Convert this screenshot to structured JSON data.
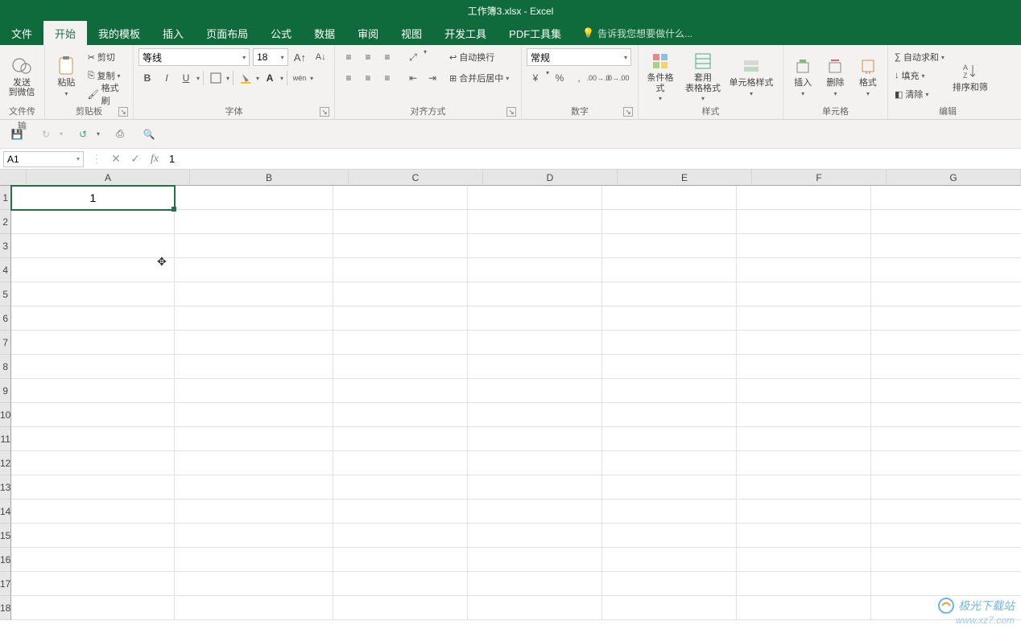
{
  "titlebar": {
    "text": "工作簿3.xlsx - Excel"
  },
  "menu": {
    "items": [
      "文件",
      "开始",
      "我的模板",
      "插入",
      "页面布局",
      "公式",
      "数据",
      "审阅",
      "视图",
      "开发工具",
      "PDF工具集"
    ],
    "active": "开始",
    "tellme_icon": "lightbulb-icon",
    "tellme": "告诉我您想要做什么..."
  },
  "ribbon": {
    "wechat": {
      "send_label": "发送",
      "to_label": "到微信",
      "group": "文件传输"
    },
    "clipboard": {
      "paste": "粘贴",
      "cut": "剪切",
      "copy": "复制",
      "painter": "格式刷",
      "group": "剪贴板"
    },
    "font": {
      "name": "等线",
      "size": "18",
      "bold": "B",
      "italic": "I",
      "underline": "U",
      "pinyin": "wén",
      "group": "字体"
    },
    "align": {
      "wrap": "自动换行",
      "merge": "合并后居中",
      "group": "对齐方式"
    },
    "number": {
      "format": "常规",
      "group": "数字"
    },
    "styles": {
      "cond": "条件格式",
      "table": "套用\n表格格式",
      "cell": "单元格样式",
      "group": "样式"
    },
    "cells": {
      "insert": "插入",
      "delete": "删除",
      "format": "格式",
      "group": "单元格"
    },
    "editing": {
      "sum": "自动求和",
      "fill": "填充",
      "clear": "清除",
      "sort": "排序和筛",
      "group": "编辑"
    }
  },
  "formula_bar": {
    "name": "A1",
    "value": "1"
  },
  "grid": {
    "columns": [
      "A",
      "B",
      "C",
      "D",
      "E",
      "F",
      "G"
    ],
    "rows": 18,
    "selected": {
      "ref": "A1",
      "value": "1"
    }
  },
  "watermark": {
    "line1": "极光下载站",
    "line2": "www.xz7.com"
  }
}
